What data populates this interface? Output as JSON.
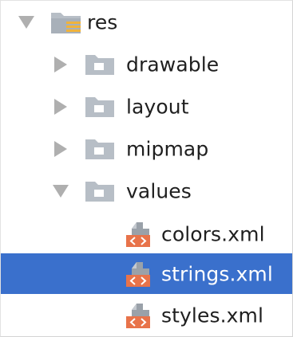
{
  "tree": {
    "root": {
      "label": "res",
      "icon": "resource-folder-icon",
      "expanded": true
    },
    "folders": [
      {
        "label": "drawable",
        "icon": "folder-icon",
        "expanded": false
      },
      {
        "label": "layout",
        "icon": "folder-icon",
        "expanded": false
      },
      {
        "label": "mipmap",
        "icon": "folder-icon",
        "expanded": false
      },
      {
        "label": "values",
        "icon": "folder-icon",
        "expanded": true
      }
    ],
    "files": [
      {
        "label": "colors.xml",
        "icon": "xml-file-icon",
        "selected": false
      },
      {
        "label": "strings.xml",
        "icon": "xml-file-icon",
        "selected": true
      },
      {
        "label": "styles.xml",
        "icon": "xml-file-icon",
        "selected": false
      }
    ]
  },
  "colors": {
    "selection": "#3a70cc",
    "arrow": "#afafaf",
    "folder": "#b7bec6",
    "xml_accent": "#e8734a"
  }
}
